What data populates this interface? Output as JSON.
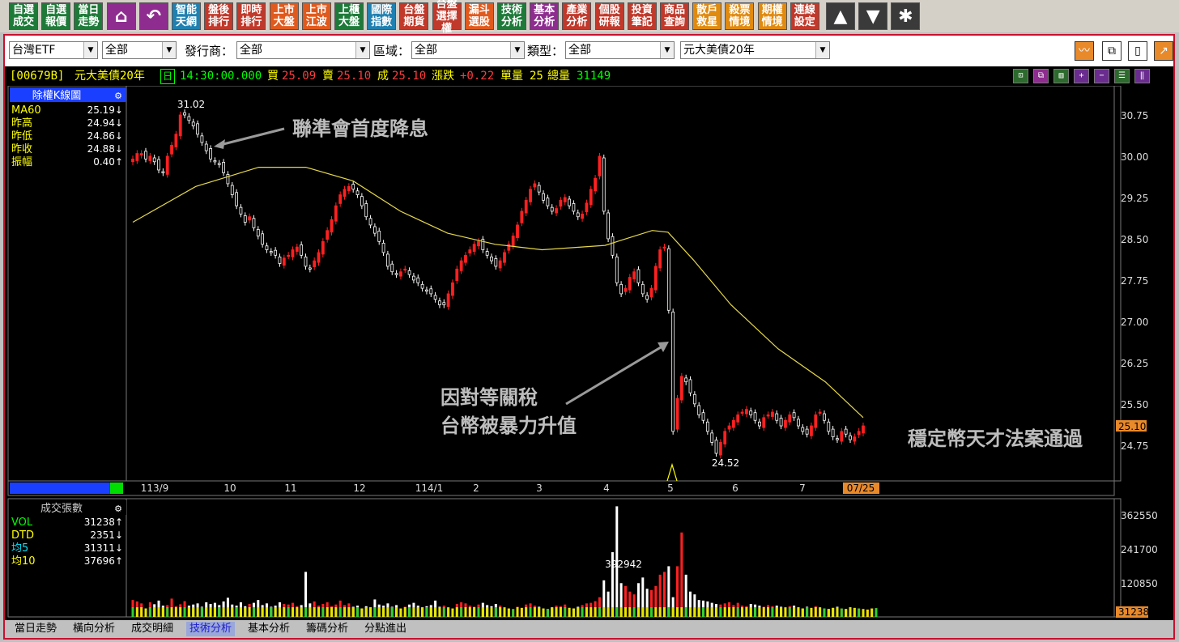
{
  "toolbar": {
    "buttons": [
      {
        "label": "自選\n成交",
        "color": "#1f7a3a"
      },
      {
        "label": "自選\n報價",
        "color": "#1f7a3a"
      },
      {
        "label": "當日\n走勢",
        "color": "#1f7a3a"
      },
      {
        "label": "⌂",
        "color": "#8e2d8f",
        "icon": true,
        "name": "home-icon"
      },
      {
        "label": "↶",
        "color": "#8e2d8f",
        "icon": true,
        "name": "back-icon"
      },
      {
        "label": "智能\n天網",
        "color": "#2080b0"
      },
      {
        "label": "盤後\n排行",
        "color": "#c0392b"
      },
      {
        "label": "即時\n排行",
        "color": "#c0392b"
      },
      {
        "label": "上市\n大盤",
        "color": "#e05a1e"
      },
      {
        "label": "上市\n江波",
        "color": "#e05a1e"
      },
      {
        "label": "上櫃\n大盤",
        "color": "#1f7a3a"
      },
      {
        "label": "國際\n指數",
        "color": "#2080b0"
      },
      {
        "label": "台盤\n期貨",
        "color": "#c0392b"
      },
      {
        "label": "台盤\n選擇權",
        "color": "#c0392b"
      },
      {
        "label": "漏斗\n選股",
        "color": "#e05a1e"
      },
      {
        "label": "技術\n分析",
        "color": "#1f7a3a"
      },
      {
        "label": "基本\n分析",
        "color": "#8e2d8f"
      },
      {
        "label": "產業\n分析",
        "color": "#c0392b"
      },
      {
        "label": "個股\n研報",
        "color": "#c0392b"
      },
      {
        "label": "投資\n筆記",
        "color": "#c0392b"
      },
      {
        "label": "商品\n查詢",
        "color": "#c0392b"
      },
      {
        "label": "散戶\n救星",
        "color": "#e08a10"
      },
      {
        "label": "殺票\n情境",
        "color": "#e08a10"
      },
      {
        "label": "期權\n情境",
        "color": "#e08a10"
      },
      {
        "label": "連線\n設定",
        "color": "#c0392b"
      },
      {
        "label": "▲",
        "color": "#333",
        "icon": true,
        "name": "arrow-up-icon"
      },
      {
        "label": "▼",
        "color": "#333",
        "icon": true,
        "name": "arrow-down-icon"
      },
      {
        "label": "✱",
        "color": "#333",
        "icon": true,
        "name": "asterisk-icon"
      }
    ]
  },
  "filters": {
    "market": "台灣ETF",
    "all1": "全部",
    "issuer_label": "發行商：",
    "issuer": "全部",
    "region_label": "區域：",
    "region": "全部",
    "type_label": "類型：",
    "type": "全部",
    "product": "元大美債20年"
  },
  "quote": {
    "code": "[00679B]",
    "name": "元大美債20年",
    "day": "日",
    "time": "14:30:00.000",
    "bid_label": "買",
    "bid": "25.09",
    "ask_label": "賣",
    "ask": "25.10",
    "deal_label": "成",
    "deal": "25.10",
    "change_label": "漲跌",
    "change": "+0.22",
    "vol_label": "單量",
    "vol": "25",
    "total_label": "總量",
    "total": "31149"
  },
  "price_panel": {
    "title": "除權K線圖",
    "rows": [
      {
        "label": "MA60",
        "value": "25.19↓",
        "color": "#ffff00"
      },
      {
        "label": "昨高",
        "value": "24.94↓",
        "color": "#ffff00"
      },
      {
        "label": "昨低",
        "value": "24.86↓",
        "color": "#ffff00"
      },
      {
        "label": "昨收",
        "value": "24.88↓",
        "color": "#ffff00"
      },
      {
        "label": "振幅",
        "value": "0.40↑",
        "color": "#ffff00"
      }
    ],
    "current_price": "25.10"
  },
  "volume_panel": {
    "title": "成交張數",
    "rows": [
      {
        "label": "VOL",
        "value": "31238↑",
        "color": "#00ff00"
      },
      {
        "label": "DTD",
        "value": "2351↓",
        "color": "#ffff00"
      },
      {
        "label": "均5",
        "value": "31311↓",
        "color": "#00e5ff"
      },
      {
        "label": "均10",
        "value": "37696↑",
        "color": "#ffff00"
      }
    ],
    "current_volume": "31238"
  },
  "annotations": {
    "fed": "聯準會首度降息",
    "tariff_line1": "因對等關稅",
    "tariff_line2": "台幣被暴力升值",
    "stablecoin": "穩定幣天才法案通過",
    "high_label": "31.02",
    "low_label": "24.52",
    "peak_vol_label": "392942"
  },
  "tabs": [
    "當日走勢",
    "橫向分析",
    "成交明細",
    "技術分析",
    "基本分析",
    "籌碼分析",
    "分點進出"
  ],
  "active_tab": 3,
  "chart_data": {
    "type": "candlestick",
    "x_ticks": [
      "113/9",
      "10",
      "11",
      "12",
      "114/1",
      "2",
      "3",
      "4",
      "5",
      "6",
      "7",
      "07/25"
    ],
    "price_axis": [
      30.75,
      30.0,
      29.25,
      28.5,
      27.75,
      27.0,
      26.25,
      25.5,
      24.75
    ],
    "price_ylim": [
      24.1,
      31.25
    ],
    "volume_axis": [
      362550,
      241700,
      120850
    ],
    "volume_ylim": [
      0,
      420000
    ],
    "ma60": [
      [
        0,
        28.8
      ],
      [
        20,
        29.45
      ],
      [
        40,
        29.8
      ],
      [
        55,
        29.8
      ],
      [
        70,
        29.55
      ],
      [
        85,
        29.0
      ],
      [
        100,
        28.6
      ],
      [
        115,
        28.4
      ],
      [
        130,
        28.3
      ],
      [
        150,
        28.38
      ],
      [
        165,
        28.65
      ],
      [
        170,
        28.62
      ],
      [
        178,
        28.12
      ],
      [
        190,
        27.3
      ],
      [
        205,
        26.5
      ],
      [
        220,
        25.9
      ],
      [
        232,
        25.25
      ]
    ],
    "closes": [
      29.95,
      30.05,
      30.05,
      29.95,
      30.0,
      29.9,
      29.75,
      29.7,
      30.0,
      30.2,
      30.4,
      30.75,
      30.75,
      30.65,
      30.55,
      30.4,
      30.25,
      30.1,
      29.95,
      29.9,
      29.85,
      29.7,
      29.5,
      29.3,
      29.1,
      28.95,
      28.8,
      28.9,
      28.7,
      28.55,
      28.4,
      28.3,
      28.25,
      28.2,
      28.05,
      28.15,
      28.2,
      28.3,
      28.35,
      28.2,
      28.0,
      27.95,
      28.1,
      28.25,
      28.45,
      28.65,
      28.85,
      29.1,
      29.3,
      29.4,
      29.45,
      29.4,
      29.3,
      29.1,
      28.9,
      28.75,
      28.6,
      28.45,
      28.25,
      28.0,
      27.9,
      27.85,
      27.9,
      27.95,
      27.85,
      27.75,
      27.7,
      27.6,
      27.55,
      27.5,
      27.4,
      27.3,
      27.3,
      27.5,
      27.7,
      27.95,
      28.1,
      28.2,
      28.3,
      28.4,
      28.45,
      28.3,
      28.2,
      28.1,
      28.0,
      28.1,
      28.25,
      28.4,
      28.55,
      28.75,
      29.0,
      29.2,
      29.4,
      29.5,
      29.35,
      29.2,
      29.1,
      29.0,
      29.05,
      29.2,
      29.25,
      29.1,
      29.0,
      28.9,
      28.95,
      29.15,
      29.4,
      29.6,
      30.0,
      29.0,
      28.5,
      28.2,
      27.7,
      27.5,
      27.6,
      27.8,
      27.9,
      27.7,
      27.5,
      27.4,
      27.6,
      28.0,
      28.3,
      28.35,
      27.2,
      25.0,
      25.6,
      26.0,
      25.9,
      25.7,
      25.5,
      25.3,
      25.2,
      25.0,
      24.8,
      24.6,
      24.8,
      25.0,
      25.1,
      25.2,
      25.3,
      25.35,
      25.4,
      25.3,
      25.2,
      25.1,
      25.25,
      25.3,
      25.35,
      25.2,
      25.1,
      25.2,
      25.3,
      25.25,
      25.1,
      25.0,
      24.95,
      25.1,
      25.3,
      25.35,
      25.2,
      25.0,
      24.9,
      24.85,
      25.0,
      24.95,
      24.85,
      24.9,
      25.0,
      25.1
    ],
    "volumes": [
      60000,
      55000,
      48000,
      30000,
      52000,
      45000,
      58000,
      40000,
      42000,
      65000,
      38000,
      45000,
      56000,
      40000,
      44000,
      48000,
      36000,
      52000,
      46000,
      50000,
      42000,
      55000,
      68000,
      44000,
      40000,
      52000,
      38000,
      46000,
      50000,
      60000,
      42000,
      48000,
      36000,
      40000,
      52000,
      46000,
      44000,
      50000,
      38000,
      42000,
      160000,
      48000,
      55000,
      40000,
      46000,
      52000,
      38000,
      44000,
      58000,
      42000,
      48000,
      36000,
      40000,
      30000,
      38000,
      34000,
      62000,
      44000,
      40000,
      48000,
      36000,
      42000,
      30000,
      36000,
      44000,
      50000,
      40000,
      34000,
      38000,
      42000,
      58000,
      36000,
      40000,
      34000,
      30000,
      46000,
      52000,
      48000,
      40000,
      36000,
      44000,
      50000,
      42000,
      38000,
      46000,
      40000,
      34000,
      30000,
      28000,
      36000,
      32000,
      44000,
      48000,
      40000,
      36000,
      30000,
      28000,
      34000,
      40000,
      38000,
      44000,
      32000,
      30000,
      36000,
      42000,
      48000,
      50000,
      56000,
      70000,
      130000,
      90000,
      230000,
      392942,
      120000,
      110000,
      90000,
      80000,
      120000,
      140000,
      100000,
      95000,
      110000,
      150000,
      160000,
      180000,
      70000,
      180000,
      300000,
      150000,
      90000,
      80000,
      60000,
      58000,
      55000,
      50000,
      46000,
      44000,
      48000,
      52000,
      42000,
      50000,
      40000,
      38000,
      46000,
      44000,
      40000,
      36000,
      42000,
      38000,
      40000,
      36000,
      34000,
      38000,
      40000,
      34000,
      30000,
      36000,
      32000,
      38000,
      34000,
      30000,
      28000,
      32000,
      36000,
      30000,
      28000,
      34000,
      32000,
      30000,
      28000,
      26000,
      30000,
      31238
    ]
  }
}
